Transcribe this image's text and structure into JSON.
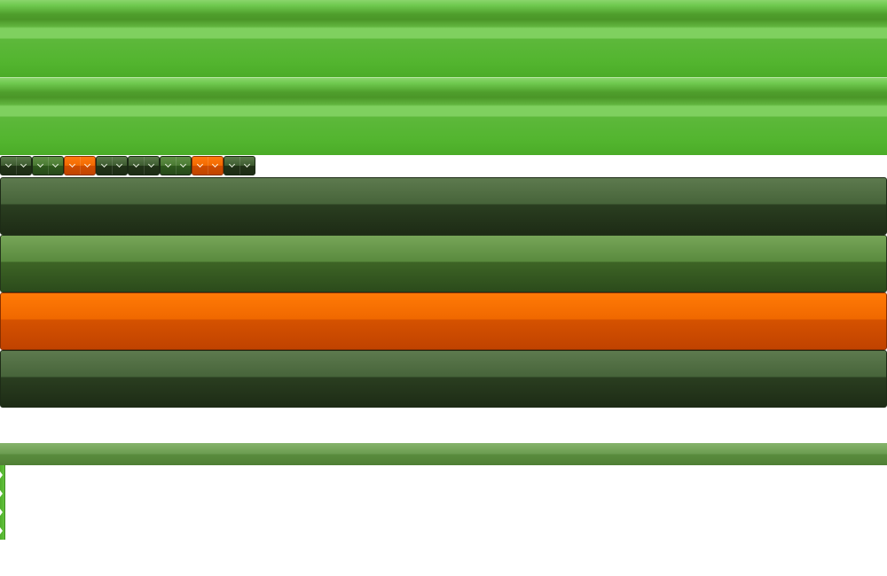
{
  "colors": {
    "bright_green": "#56b730",
    "dark_green": "#2a3e20",
    "mid_green": "#5a8a3e",
    "orange": "#f06800"
  },
  "dropdown_strip": {
    "buttons": [
      {
        "style": "dark",
        "icon": "chevron-down-icon"
      },
      {
        "style": "mid",
        "icon": "chevron-down-icon"
      },
      {
        "style": "orange",
        "icon": "chevron-down-icon"
      },
      {
        "style": "dark",
        "icon": "chevron-down-icon"
      },
      {
        "style": "dark",
        "icon": "chevron-down-icon"
      },
      {
        "style": "mid",
        "icon": "chevron-down-icon"
      },
      {
        "style": "orange",
        "icon": "chevron-down-icon"
      },
      {
        "style": "dark",
        "icon": "chevron-down-icon"
      }
    ]
  },
  "bars": [
    {
      "style": "dark"
    },
    {
      "style": "green"
    },
    {
      "style": "orange"
    },
    {
      "style": "dark"
    }
  ],
  "side_tabs": 4
}
